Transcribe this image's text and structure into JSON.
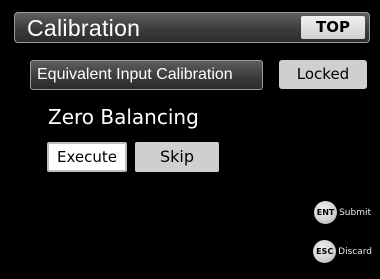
{
  "header": {
    "title": "Calibration",
    "top_button": "TOP"
  },
  "calibration": {
    "mode_button": "Equivalent Input Calibration",
    "status": "Locked"
  },
  "zero_balancing": {
    "title": "Zero Balancing",
    "execute_label": "Execute",
    "skip_label": "Skip"
  },
  "keys": {
    "ent": {
      "icon_text": "ENT",
      "label": "Submit",
      "icon": "ent-key-icon"
    },
    "esc": {
      "icon_text": "ESC",
      "label": "Discard",
      "icon": "esc-key-icon"
    }
  },
  "colors": {
    "background": "#000000",
    "button_light": "#cfcfcf",
    "button_dark": "#3c3c3c",
    "selected": "#ffffff"
  }
}
